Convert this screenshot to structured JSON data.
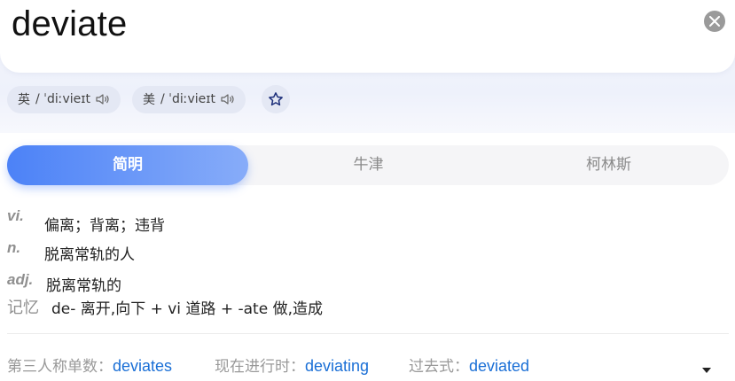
{
  "search": {
    "query": "deviate"
  },
  "pronunciations": [
    {
      "region": "英",
      "ipa": "/ ˈdiːvieɪt"
    },
    {
      "region": "美",
      "ipa": "/ ˈdiːvieɪt"
    }
  ],
  "tabs": [
    {
      "label": "简明",
      "active": true
    },
    {
      "label": "牛津",
      "active": false
    },
    {
      "label": "柯林斯",
      "active": false
    }
  ],
  "definitions": [
    {
      "pos": "vi.",
      "meaning": "偏离；背离；违背"
    },
    {
      "pos": "n.",
      "meaning": "脱离常轨的人"
    },
    {
      "pos": "adj.",
      "meaning": "脱离常轨的"
    }
  ],
  "memo": {
    "label": "记忆",
    "text": "de- 离开,向下 + vi 道路 + -ate 做,造成"
  },
  "word_forms": [
    {
      "label": "第三人称单数：",
      "value": "deviates"
    },
    {
      "label": "现在进行时：",
      "value": "deviating"
    },
    {
      "label": "过去式：",
      "value": "deviated"
    }
  ],
  "colors": {
    "accent": "#4c82f7",
    "link": "#1a6fd6",
    "muted": "#8f8f8f"
  },
  "icons": [
    "clear-icon",
    "speaker-icon",
    "star-icon",
    "caret-down-icon"
  ]
}
